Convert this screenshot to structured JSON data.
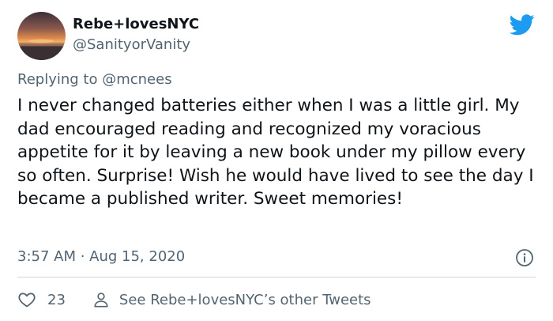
{
  "author": {
    "display_name": "Rebe+lovesNYC",
    "handle": "@SanityorVanity"
  },
  "reply": {
    "prefix": "Replying to ",
    "mention": "@mcnees"
  },
  "tweet": {
    "text": "I never changed batteries either when I was a little girl. My dad encouraged reading and recognized my voracious appetite for it by leaving a new book under my pillow every so often. Surprise! Wish he would have lived to see the day I became a published writer. Sweet memories!"
  },
  "meta": {
    "timestamp": "3:57 AM · Aug 15, 2020"
  },
  "actions": {
    "like_count": "23",
    "profile_link_label": "See Rebe+lovesNYC’s other Tweets"
  },
  "icons": {
    "logo": "twitter-bird-icon",
    "info": "info-icon",
    "like": "heart-icon",
    "profile": "person-icon"
  },
  "colors": {
    "brand": "#1d9bf0",
    "text_primary": "#0f1419",
    "text_secondary": "#536471",
    "divider": "#cfd9de"
  }
}
